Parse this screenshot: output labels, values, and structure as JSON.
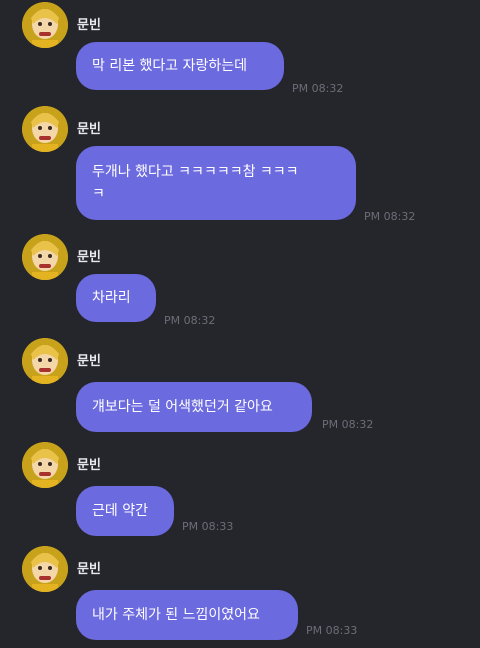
{
  "theme": {
    "background": "#25252c",
    "bubble_color": "#6c6adf",
    "avatar_color": "#c9a21c"
  },
  "messages": [
    {
      "sender": "문빈",
      "text": "막 리본 했다고 자랑하는데",
      "time": "PM 08:32"
    },
    {
      "sender": "문빈",
      "text": "두개나 했다고 ㅋㅋㅋㅋㅋ참 ㅋㅋㅋ\nㅋ",
      "time": "PM 08:32"
    },
    {
      "sender": "문빈",
      "text": "차라리",
      "time": "PM 08:32"
    },
    {
      "sender": "문빈",
      "text": "걔보다는 덜 어색했던거 같아요",
      "time": "PM 08:32"
    },
    {
      "sender": "문빈",
      "text": "근데 약간",
      "time": "PM 08:33"
    },
    {
      "sender": "문빈",
      "text": "내가 주체가 된 느낌이였어요",
      "time": "PM 08:33"
    }
  ]
}
